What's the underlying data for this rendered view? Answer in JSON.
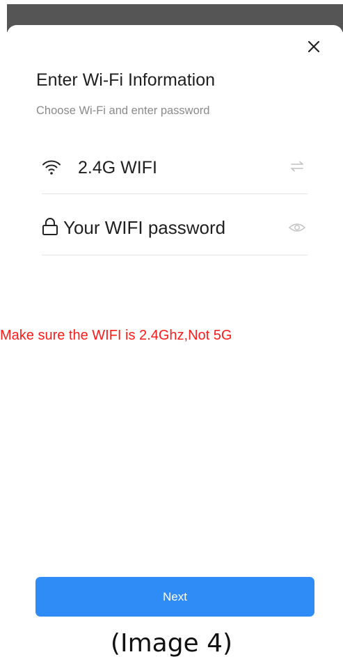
{
  "dialog": {
    "title": "Enter Wi-Fi Information",
    "subtitle": "Choose Wi-Fi and enter password",
    "close_icon": "close-icon"
  },
  "wifi": {
    "ssid": "2.4G WIFI",
    "icon": "wifi-icon",
    "switch_icon": "switch-network-icon"
  },
  "password": {
    "placeholder": "Your WIFI password",
    "icon": "lock-icon",
    "visibility_icon": "eye-icon"
  },
  "warning": {
    "text": "Make sure the WIFI is 2.4Ghz,Not 5G",
    "color": "#ff1a1a"
  },
  "actions": {
    "next_label": "Next",
    "accent": "#2f8cf6"
  },
  "caption": "(Image 4)"
}
